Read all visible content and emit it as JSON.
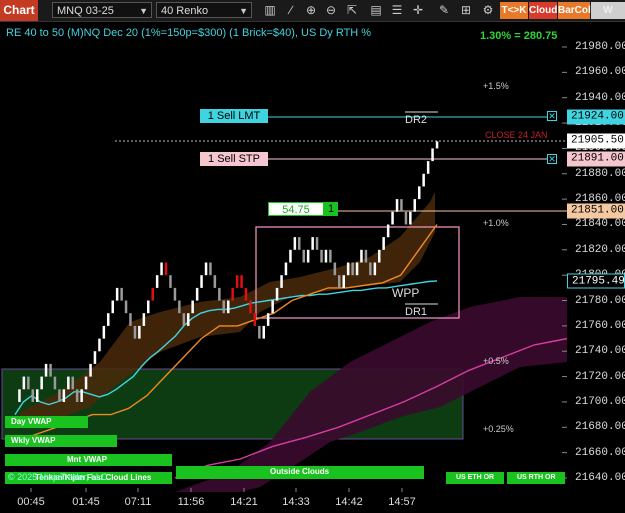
{
  "toolbar": {
    "title": "Chart",
    "instrument": "MNQ 03-25",
    "bar_type": "40 Renko",
    "buttons": [
      {
        "label": "T<>K",
        "color": "#e8792a"
      },
      {
        "label": "Cloud",
        "color": "#d83a2b"
      },
      {
        "label": "BarCol",
        "color": "#e8792a"
      },
      {
        "label": "W VWAP",
        "color": "#cfcfcf"
      }
    ],
    "icons": [
      "bar-chart-icon",
      "draw-line-icon",
      "zoom-in-icon",
      "zoom-out-icon",
      "pointer-icon",
      "strategies-icon",
      "properties-icon",
      "crosshair-icon",
      "drawing-tools-icon",
      "ruler-icon",
      "settings-icon"
    ]
  },
  "header": {
    "description": "RE 40 to 50 (M)NQ Dec 20 (1%=150p=$300) (1 Brick=$40), US Dy RTH %",
    "pct_readout": "1.30% = 280.75"
  },
  "orders": {
    "sell_lmt": {
      "label": "1 Sell LMT",
      "price": "21924.00"
    },
    "sell_stp": {
      "label": "1 Sell STP",
      "price": "21891.00"
    },
    "position": {
      "pnl": "54.75",
      "qty": "1",
      "price": "21851.00"
    }
  },
  "last_price": "21905.50",
  "wpp_price": "21795.49",
  "chart_labels": {
    "close": "CLOSE 24 JAN",
    "dr2": "DR2",
    "dr1": "DR1",
    "wpp": "WPP",
    "pct_1_5": "+1.5%",
    "pct_1_0": "+1.0%",
    "pct_0_5": "+0.5%",
    "pct_0_25": "+0.25%"
  },
  "bottom_bars": {
    "day_vwap": "Day VWAP",
    "wkly_vwap": "Wkly VWAP",
    "mnt_vwap": "Mnt VWAP",
    "cloud_lines": "Tenkan/Kijun Fast Cloud Lines",
    "outside_clouds": "Outside Clouds",
    "us_eth": "US ETH OR",
    "us_rth": "US RTH OR"
  },
  "copyright": "© 2025 NinjaTrader, LLC",
  "colors": {
    "ask_cyan": "#3fd4e0",
    "stop_pink": "#f6c6cf",
    "position_green": "#19c21e",
    "orange_line": "#f08a24",
    "magenta_line": "#d83ca2",
    "vwap_green": "#19c21e"
  },
  "chart_data": {
    "type": "line",
    "chart_style": "renko",
    "brick_size": 10,
    "y_ticks": [
      21640,
      21660,
      21680,
      21700,
      21720,
      21740,
      21760,
      21780,
      21800,
      21820,
      21840,
      21860,
      21880,
      21900,
      21920,
      21940,
      21960,
      21980
    ],
    "ylim": [
      21632,
      21992
    ],
    "x_ticks": [
      "00:45",
      "01:45",
      "07:11",
      "11:56",
      "14:21",
      "14:33",
      "14:42",
      "14:57"
    ],
    "close_series": [
      21700,
      21710,
      21720,
      21710,
      21700,
      21710,
      21720,
      21730,
      21720,
      21710,
      21700,
      21710,
      21720,
      21710,
      21700,
      21710,
      21720,
      21730,
      21740,
      21750,
      21760,
      21770,
      21780,
      21790,
      21780,
      21770,
      21760,
      21750,
      21760,
      21770,
      21780,
      21790,
      21800,
      21810,
      21800,
      21790,
      21780,
      21770,
      21760,
      21770,
      21780,
      21790,
      21800,
      21810,
      21800,
      21790,
      21780,
      21770,
      21780,
      21790,
      21800,
      21790,
      21780,
      21770,
      21760,
      21750,
      21760,
      21770,
      21780,
      21790,
      21800,
      21810,
      21820,
      21830,
      21820,
      21810,
      21820,
      21830,
      21820,
      21810,
      21820,
      21810,
      21800,
      21790,
      21800,
      21810,
      21800,
      21810,
      21820,
      21810,
      21800,
      21810,
      21820,
      21830,
      21840,
      21850,
      21860,
      21850,
      21840,
      21850,
      21860,
      21870,
      21880,
      21890,
      21900,
      21905.5
    ],
    "down_red_indices": [
      31,
      34,
      49,
      50,
      51,
      52,
      53,
      54
    ],
    "series": [
      {
        "name": "WPP",
        "color": "#3fd4e0",
        "values": [
          21690,
          21700,
          21705,
          21700,
          21698,
          21700,
          21703,
          21708,
          21708,
          21706,
          21704,
          21706,
          21710,
          21715,
          21720,
          21728,
          21735,
          21740,
          21746,
          21752,
          21760,
          21766,
          21770,
          21772,
          21773,
          21773,
          21774,
          21776,
          21778,
          21779,
          21780,
          21781,
          21782,
          21783,
          21784,
          21784,
          21785,
          21785,
          21786,
          21787,
          21788,
          21788,
          21789,
          21790,
          21790,
          21791,
          21792,
          21793,
          21794,
          21795,
          21795.49
        ]
      },
      {
        "color": "#f08a24",
        "values": [
          21670,
          21675,
          21680,
          21685,
          21690,
          21690,
          21695,
          21705,
          21720,
          21735,
          21750,
          21760,
          21760,
          21765,
          21770,
          21780,
          21785,
          21790,
          21790,
          21792,
          21794,
          21800,
          21820,
          21840
        ]
      },
      {
        "color": "#d83ca2",
        "values": [
          21640,
          21650,
          21655,
          21665,
          21672,
          21680,
          21690,
          21700,
          21712,
          21725,
          21735,
          21745,
          21750
        ]
      }
    ]
  }
}
